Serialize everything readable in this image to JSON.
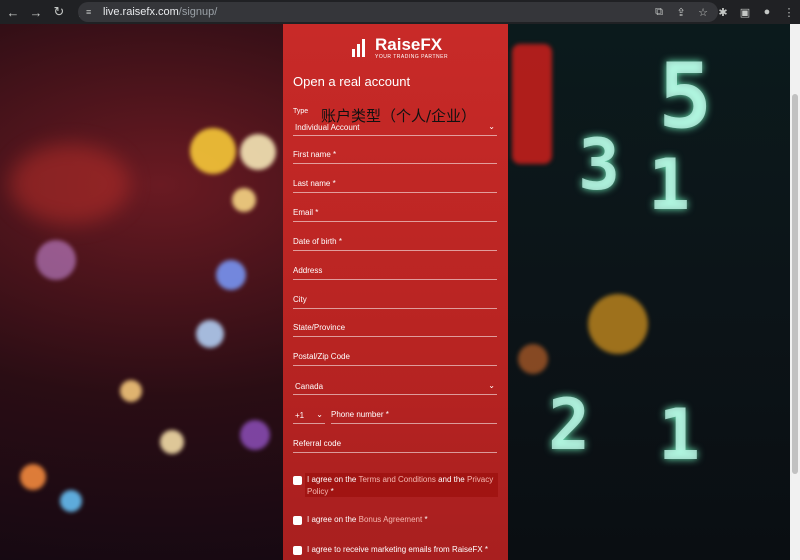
{
  "browser": {
    "url_host": "live.raisefx.com",
    "url_path": "/signup/"
  },
  "brand": {
    "name": "RaiseFX",
    "tagline": "YOUR TRADING PARTNER"
  },
  "form": {
    "title": "Open a real account",
    "type_label": "Type",
    "type_annotation": "账户类型（个人/企业）",
    "account_type": "Individual Account",
    "first_name_label": "First name",
    "last_name_label": "Last name",
    "email_label": "Email",
    "dob_label": "Date of birth",
    "address_label": "Address",
    "city_label": "City",
    "state_label": "State/Province",
    "zip_label": "Postal/Zip Code",
    "country": "Canada",
    "phone_code": "+1",
    "phone_label": "Phone number",
    "referral_label": "Referral code",
    "required_mark": "*",
    "terms_prefix": "I agree on the",
    "terms_link": "Terms and Conditions",
    "terms_mid": "and the",
    "terms_link2": "Privacy Policy",
    "bonus_prefix": "I agree on the",
    "bonus_link": "Bonus Agreement",
    "marketing": "I agree to receive marketing emails from RaiseFX"
  },
  "colors": {
    "panel": "#c82a28",
    "link": "#f5b7b0"
  }
}
